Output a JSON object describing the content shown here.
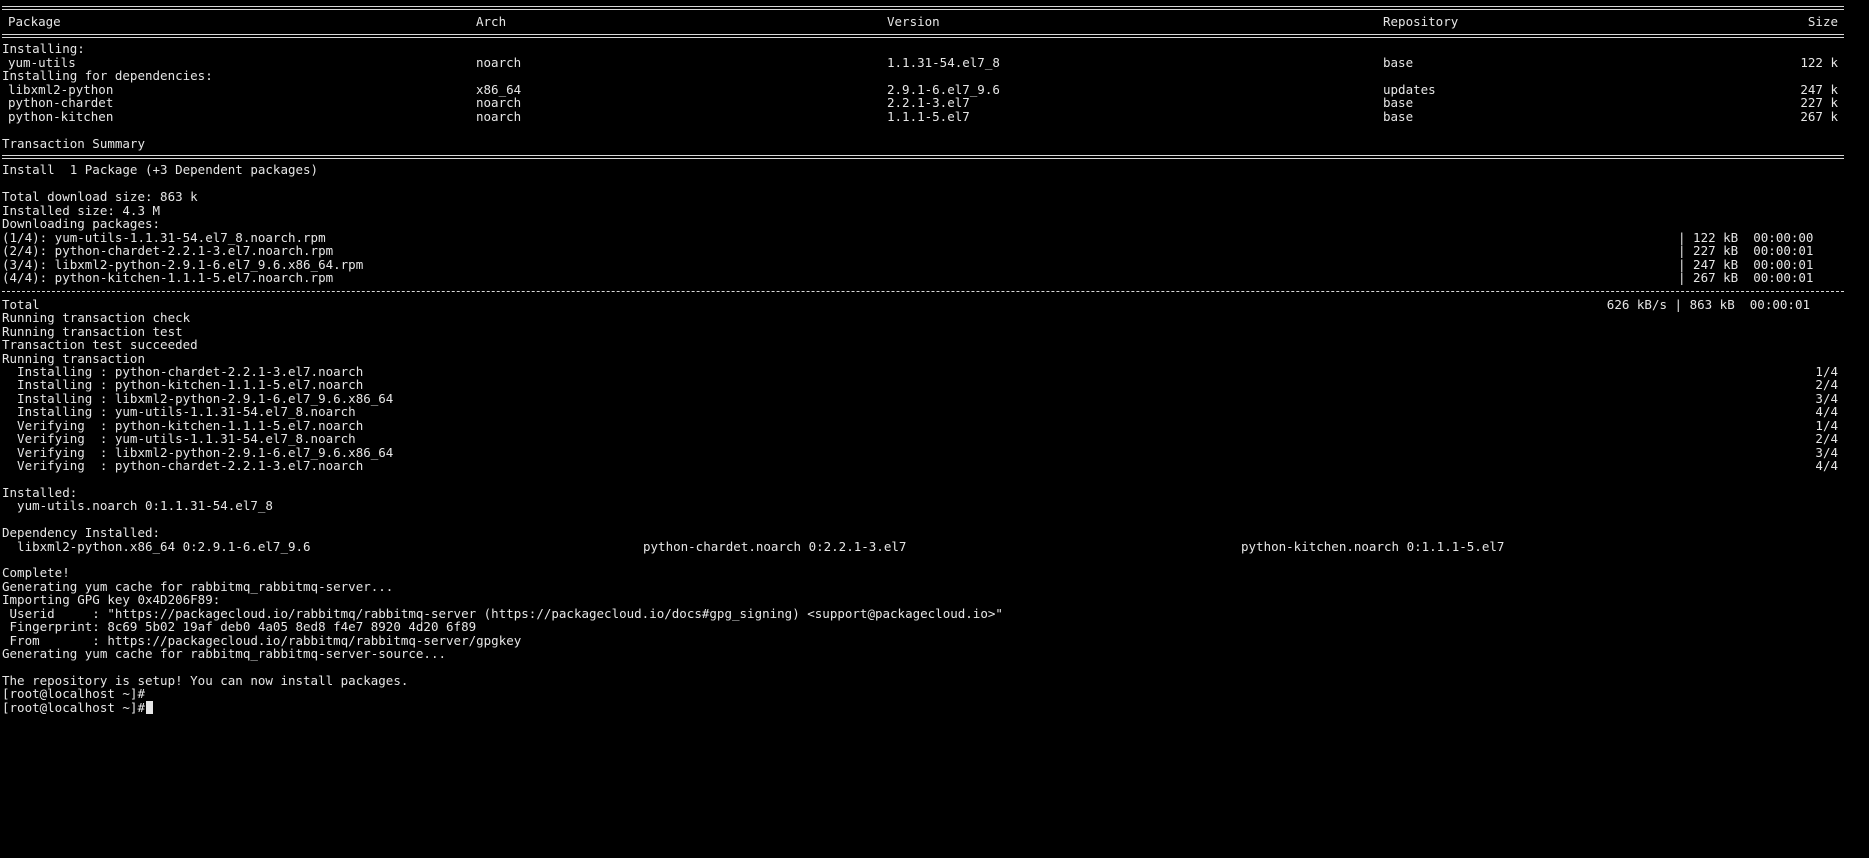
{
  "table": {
    "headers": {
      "package": "Package",
      "arch": "Arch",
      "version": "Version",
      "repository": "Repository",
      "size": "Size"
    },
    "installing_label": "Installing:",
    "main_rows": [
      {
        "package": "yum-utils",
        "arch": "noarch",
        "version": "1.1.31-54.el7_8",
        "repository": "base",
        "size": "122 k"
      }
    ],
    "deps_label": "Installing for dependencies:",
    "dep_rows": [
      {
        "package": "libxml2-python",
        "arch": "x86_64",
        "version": "2.9.1-6.el7_9.6",
        "repository": "updates",
        "size": "247 k"
      },
      {
        "package": "python-chardet",
        "arch": "noarch",
        "version": "2.2.1-3.el7",
        "repository": "base",
        "size": "227 k"
      },
      {
        "package": "python-kitchen",
        "arch": "noarch",
        "version": "1.1.1-5.el7",
        "repository": "base",
        "size": "267 k"
      }
    ]
  },
  "summary": {
    "title": "Transaction Summary",
    "install_line": "Install  1 Package (+3 Dependent packages)",
    "download_size": "Total download size: 863 k",
    "installed_size": "Installed size: 4.3 M",
    "downloading_label": "Downloading packages:"
  },
  "downloads": [
    {
      "file": "(1/4): yum-utils-1.1.31-54.el7_8.noarch.rpm",
      "stats": "| 122 kB  00:00:00"
    },
    {
      "file": "(2/4): python-chardet-2.2.1-3.el7.noarch.rpm",
      "stats": "| 227 kB  00:00:01"
    },
    {
      "file": "(3/4): libxml2-python-2.9.1-6.el7_9.6.x86_64.rpm",
      "stats": "| 247 kB  00:00:01"
    },
    {
      "file": "(4/4): python-kitchen-1.1.1-5.el7.noarch.rpm",
      "stats": "| 267 kB  00:00:01"
    }
  ],
  "total": {
    "label": "Total",
    "stats": "626 kB/s | 863 kB  00:00:01"
  },
  "transaction": {
    "check": "Running transaction check",
    "test": "Running transaction test",
    "test_ok": "Transaction test succeeded",
    "running": "Running transaction",
    "steps": [
      {
        "text": "  Installing : python-chardet-2.2.1-3.el7.noarch",
        "count": "1/4"
      },
      {
        "text": "  Installing : python-kitchen-1.1.1-5.el7.noarch",
        "count": "2/4"
      },
      {
        "text": "  Installing : libxml2-python-2.9.1-6.el7_9.6.x86_64",
        "count": "3/4"
      },
      {
        "text": "  Installing : yum-utils-1.1.31-54.el7_8.noarch",
        "count": "4/4"
      },
      {
        "text": "  Verifying  : python-kitchen-1.1.1-5.el7.noarch",
        "count": "1/4"
      },
      {
        "text": "  Verifying  : yum-utils-1.1.31-54.el7_8.noarch",
        "count": "2/4"
      },
      {
        "text": "  Verifying  : libxml2-python-2.9.1-6.el7_9.6.x86_64",
        "count": "3/4"
      },
      {
        "text": "  Verifying  : python-chardet-2.2.1-3.el7.noarch",
        "count": "4/4"
      }
    ]
  },
  "installed": {
    "label": "Installed:",
    "item": "  yum-utils.noarch 0:1.1.31-54.el7_8"
  },
  "dependency_installed": {
    "label": "Dependency Installed:",
    "items": [
      "  libxml2-python.x86_64 0:2.9.1-6.el7_9.6",
      "python-chardet.noarch 0:2.2.1-3.el7",
      "python-kitchen.noarch 0:1.1.1-5.el7"
    ]
  },
  "tail": {
    "complete": "Complete!",
    "gen_cache": "Generating yum cache for rabbitmq_rabbitmq-server...",
    "import_key": "Importing GPG key 0x4D206F89:",
    "userid": " Userid     : \"https://packagecloud.io/rabbitmq/rabbitmq-server (https://packagecloud.io/docs#gpg_signing) <support@packagecloud.io>\"",
    "fingerprint": " Fingerprint: 8c69 5b02 19af deb0 4a05 8ed8 f4e7 8920 4d20 6f89",
    "from": " From       : https://packagecloud.io/rabbitmq/rabbitmq-server/gpgkey",
    "gen_cache_source": "Generating yum cache for rabbitmq_rabbitmq-server-source...",
    "setup_done": "The repository is setup! You can now install packages.",
    "prompt1": "[root@localhost ~]#",
    "prompt2": "[root@localhost ~]#"
  }
}
